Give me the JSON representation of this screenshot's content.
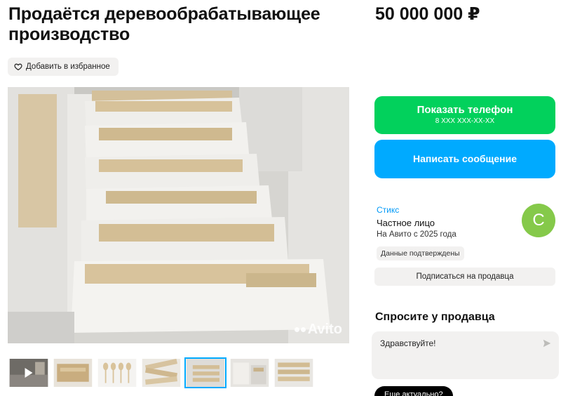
{
  "listing": {
    "title": "Продаётся деревообрабатывающее производство",
    "price": "50 000 000 ₽",
    "favorite_label": "Добавить в избранное"
  },
  "gallery": {
    "watermark": "Avito",
    "thumbnail_count": 7,
    "active_thumbnail": 5,
    "thumbnails": [
      {
        "type": "video",
        "icon": "play-icon"
      },
      {
        "type": "photo"
      },
      {
        "type": "photo"
      },
      {
        "type": "photo"
      },
      {
        "type": "photo"
      },
      {
        "type": "photo"
      },
      {
        "type": "photo"
      }
    ]
  },
  "contact": {
    "show_phone_label": "Показать телефон",
    "phone_masked": "8 XXX XXX-XX-XX",
    "message_label": "Написать сообщение"
  },
  "seller": {
    "name": "Стикс",
    "type": "Частное лицо",
    "since": "На Авито с 2025 года",
    "avatar_letter": "С",
    "avatar_color": "#85c94a",
    "verified": "Данные подтверждены",
    "subscribe_label": "Подписаться на продавца"
  },
  "ask": {
    "title": "Спросите у продавца",
    "input_value": "Здравствуйте!",
    "chip_label": "Еще актуально?"
  },
  "colors": {
    "phone_button": "#02d15c",
    "message_button": "#00aaff",
    "link": "#0099f7"
  }
}
